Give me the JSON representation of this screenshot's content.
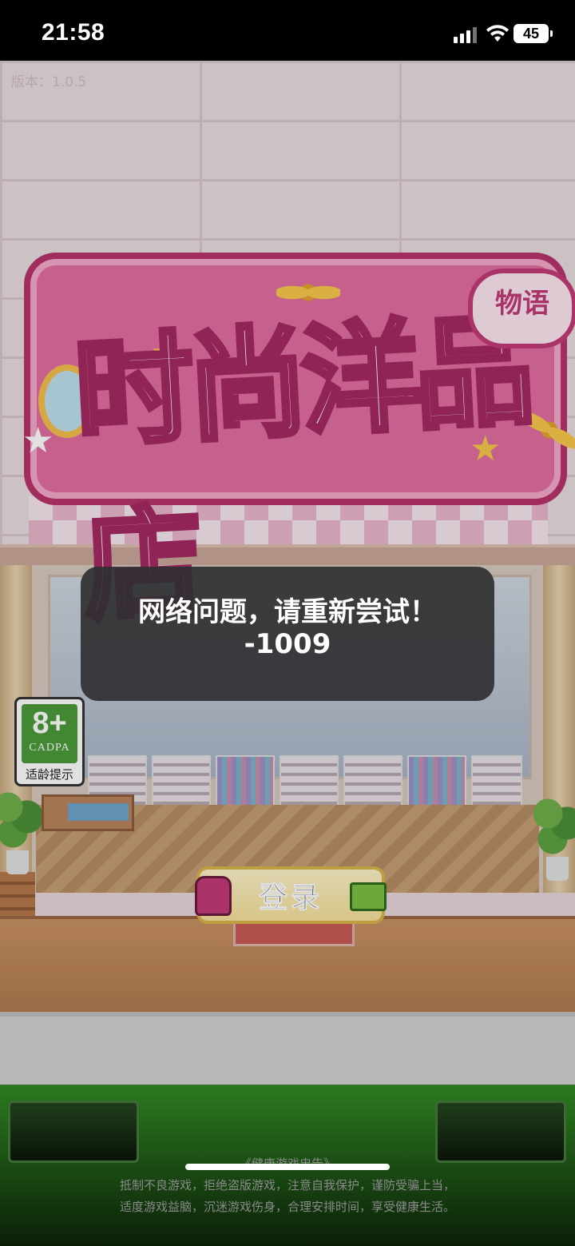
{
  "status_bar": {
    "time": "21:58",
    "battery": "45",
    "icons": [
      "cellular-signal-icon",
      "wifi-icon",
      "battery-icon"
    ]
  },
  "game": {
    "version": "版本：1.0.5",
    "logo_badge": "物语",
    "logo_title": "时尚洋品店",
    "login_label": "登录",
    "age_rating": {
      "age": "8+",
      "org": "CADPA",
      "tip": "适龄提示"
    }
  },
  "toast": {
    "message": "网络问题，请重新尝试！",
    "code": "-1009"
  },
  "health_notice": {
    "title": "《健康游戏忠告》",
    "line1": "抵制不良游戏，拒绝盗版游戏，注意自我保护，谨防受骗上当，",
    "line2": "适度游戏益脑，沉迷游戏伤身，合理安排时间，享受健康生活。"
  },
  "colors": {
    "brand_pink": "#e26fa2",
    "rating_green": "#4c9a3a",
    "toast_bg": "#303032",
    "notice_band": "#2b7a1f"
  }
}
